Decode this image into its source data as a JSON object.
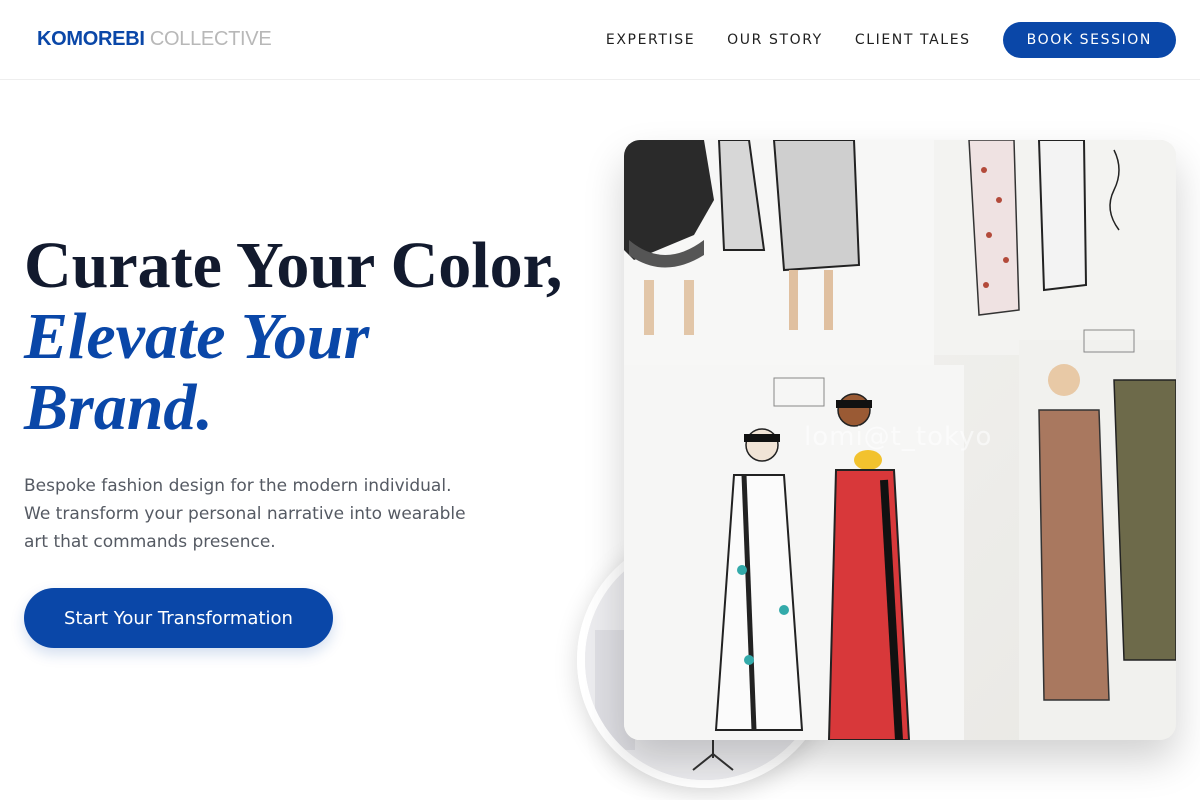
{
  "header": {
    "logo_brand": "KOMOREBI",
    "logo_suffix": "COLLECTIVE",
    "nav": [
      "EXPERTISE",
      "OUR STORY",
      "CLIENT TALES"
    ],
    "cta": "BOOK SESSION"
  },
  "hero": {
    "title_line1": "Curate Your Color,",
    "title_accent_line1": "Elevate Your",
    "title_accent_line2": "Brand.",
    "subtitle": "Bespoke fashion design for the modern individual. We transform your personal narrative into wearable art that commands presence.",
    "button": "Start Your Transformation"
  },
  "image": {
    "watermark": "lomi@t_tokyo",
    "alt": "fashion-sketches-icon"
  },
  "colors": {
    "accent": "#0a47a8",
    "heading": "#121a2e",
    "muted": "#555a63"
  }
}
